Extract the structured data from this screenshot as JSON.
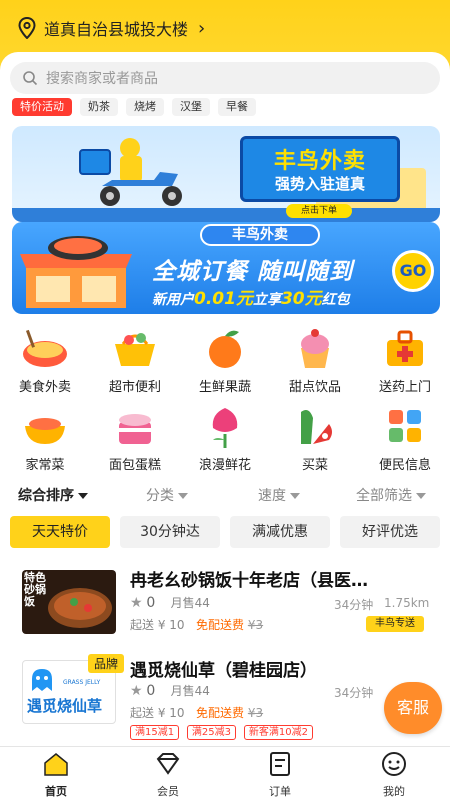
{
  "header": {
    "location": "道真自治县城投大楼"
  },
  "search": {
    "placeholder": "搜索商家或者商品"
  },
  "hot_chips": [
    "特价活动",
    "奶茶",
    "烧烤",
    "汉堡",
    "早餐"
  ],
  "banner1": {
    "title": "丰鸟外卖",
    "subtitle": "强势入驻道真",
    "button": "点击下单"
  },
  "banner2": {
    "tag": "丰鸟外卖",
    "headline": "全城订餐 随叫随到",
    "sub_prefix": "新用户",
    "sub_price": "0.01元",
    "sub_mid": "立享",
    "sub_amount": "30元",
    "sub_suffix": "红包",
    "go": "GO"
  },
  "categories": [
    {
      "label": "美食外卖",
      "icon": "food-icon"
    },
    {
      "label": "超市便利",
      "icon": "basket-icon"
    },
    {
      "label": "生鲜果蔬",
      "icon": "fruit-icon"
    },
    {
      "label": "甜点饮品",
      "icon": "dessert-icon"
    },
    {
      "label": "送药上门",
      "icon": "medicine-icon"
    },
    {
      "label": "家常菜",
      "icon": "dish-icon"
    },
    {
      "label": "面包蛋糕",
      "icon": "cake-icon"
    },
    {
      "label": "浪漫鲜花",
      "icon": "flower-icon"
    },
    {
      "label": "买菜",
      "icon": "vegetable-icon"
    },
    {
      "label": "便民信息",
      "icon": "grid-icon"
    }
  ],
  "sort": {
    "comprehensive": "综合排序",
    "category": "分类",
    "speed": "速度",
    "all_filter": "全部筛选"
  },
  "filters": [
    "天天特价",
    "30分钟达",
    "满减优惠",
    "好评优选"
  ],
  "shops": [
    {
      "name": "冉老幺砂锅饭十年老店（县医…",
      "rating": "0",
      "monthly": "月售44",
      "time": "34分钟",
      "distance": "1.75km",
      "start": "起送 ¥ 10",
      "free": "免配送费",
      "old_fee": "¥3",
      "delivery_badge": "丰鸟专送",
      "thumb_text": "特色砂锅饭"
    },
    {
      "name": "遇觅烧仙草（碧桂园店）",
      "rating": "0",
      "monthly": "月售44",
      "time": "34分钟",
      "start": "起送 ¥ 10",
      "free": "免配送费",
      "old_fee": "¥3",
      "brand": "品牌",
      "logo_text": "遇觅烧仙草",
      "logo_sub": "GRASS JELLY",
      "promos": [
        "满15减1",
        "满25减3",
        "新客满10减2"
      ]
    }
  ],
  "service": "客服",
  "tabs": [
    {
      "label": "首页",
      "icon": "home-icon"
    },
    {
      "label": "会员",
      "icon": "diamond-icon"
    },
    {
      "label": "订单",
      "icon": "order-icon"
    },
    {
      "label": "我的",
      "icon": "profile-icon"
    }
  ],
  "colors": {
    "brand_yellow": "#ffd21a",
    "accent_orange": "#ff8c2a",
    "promo_red": "#ff3b30"
  }
}
